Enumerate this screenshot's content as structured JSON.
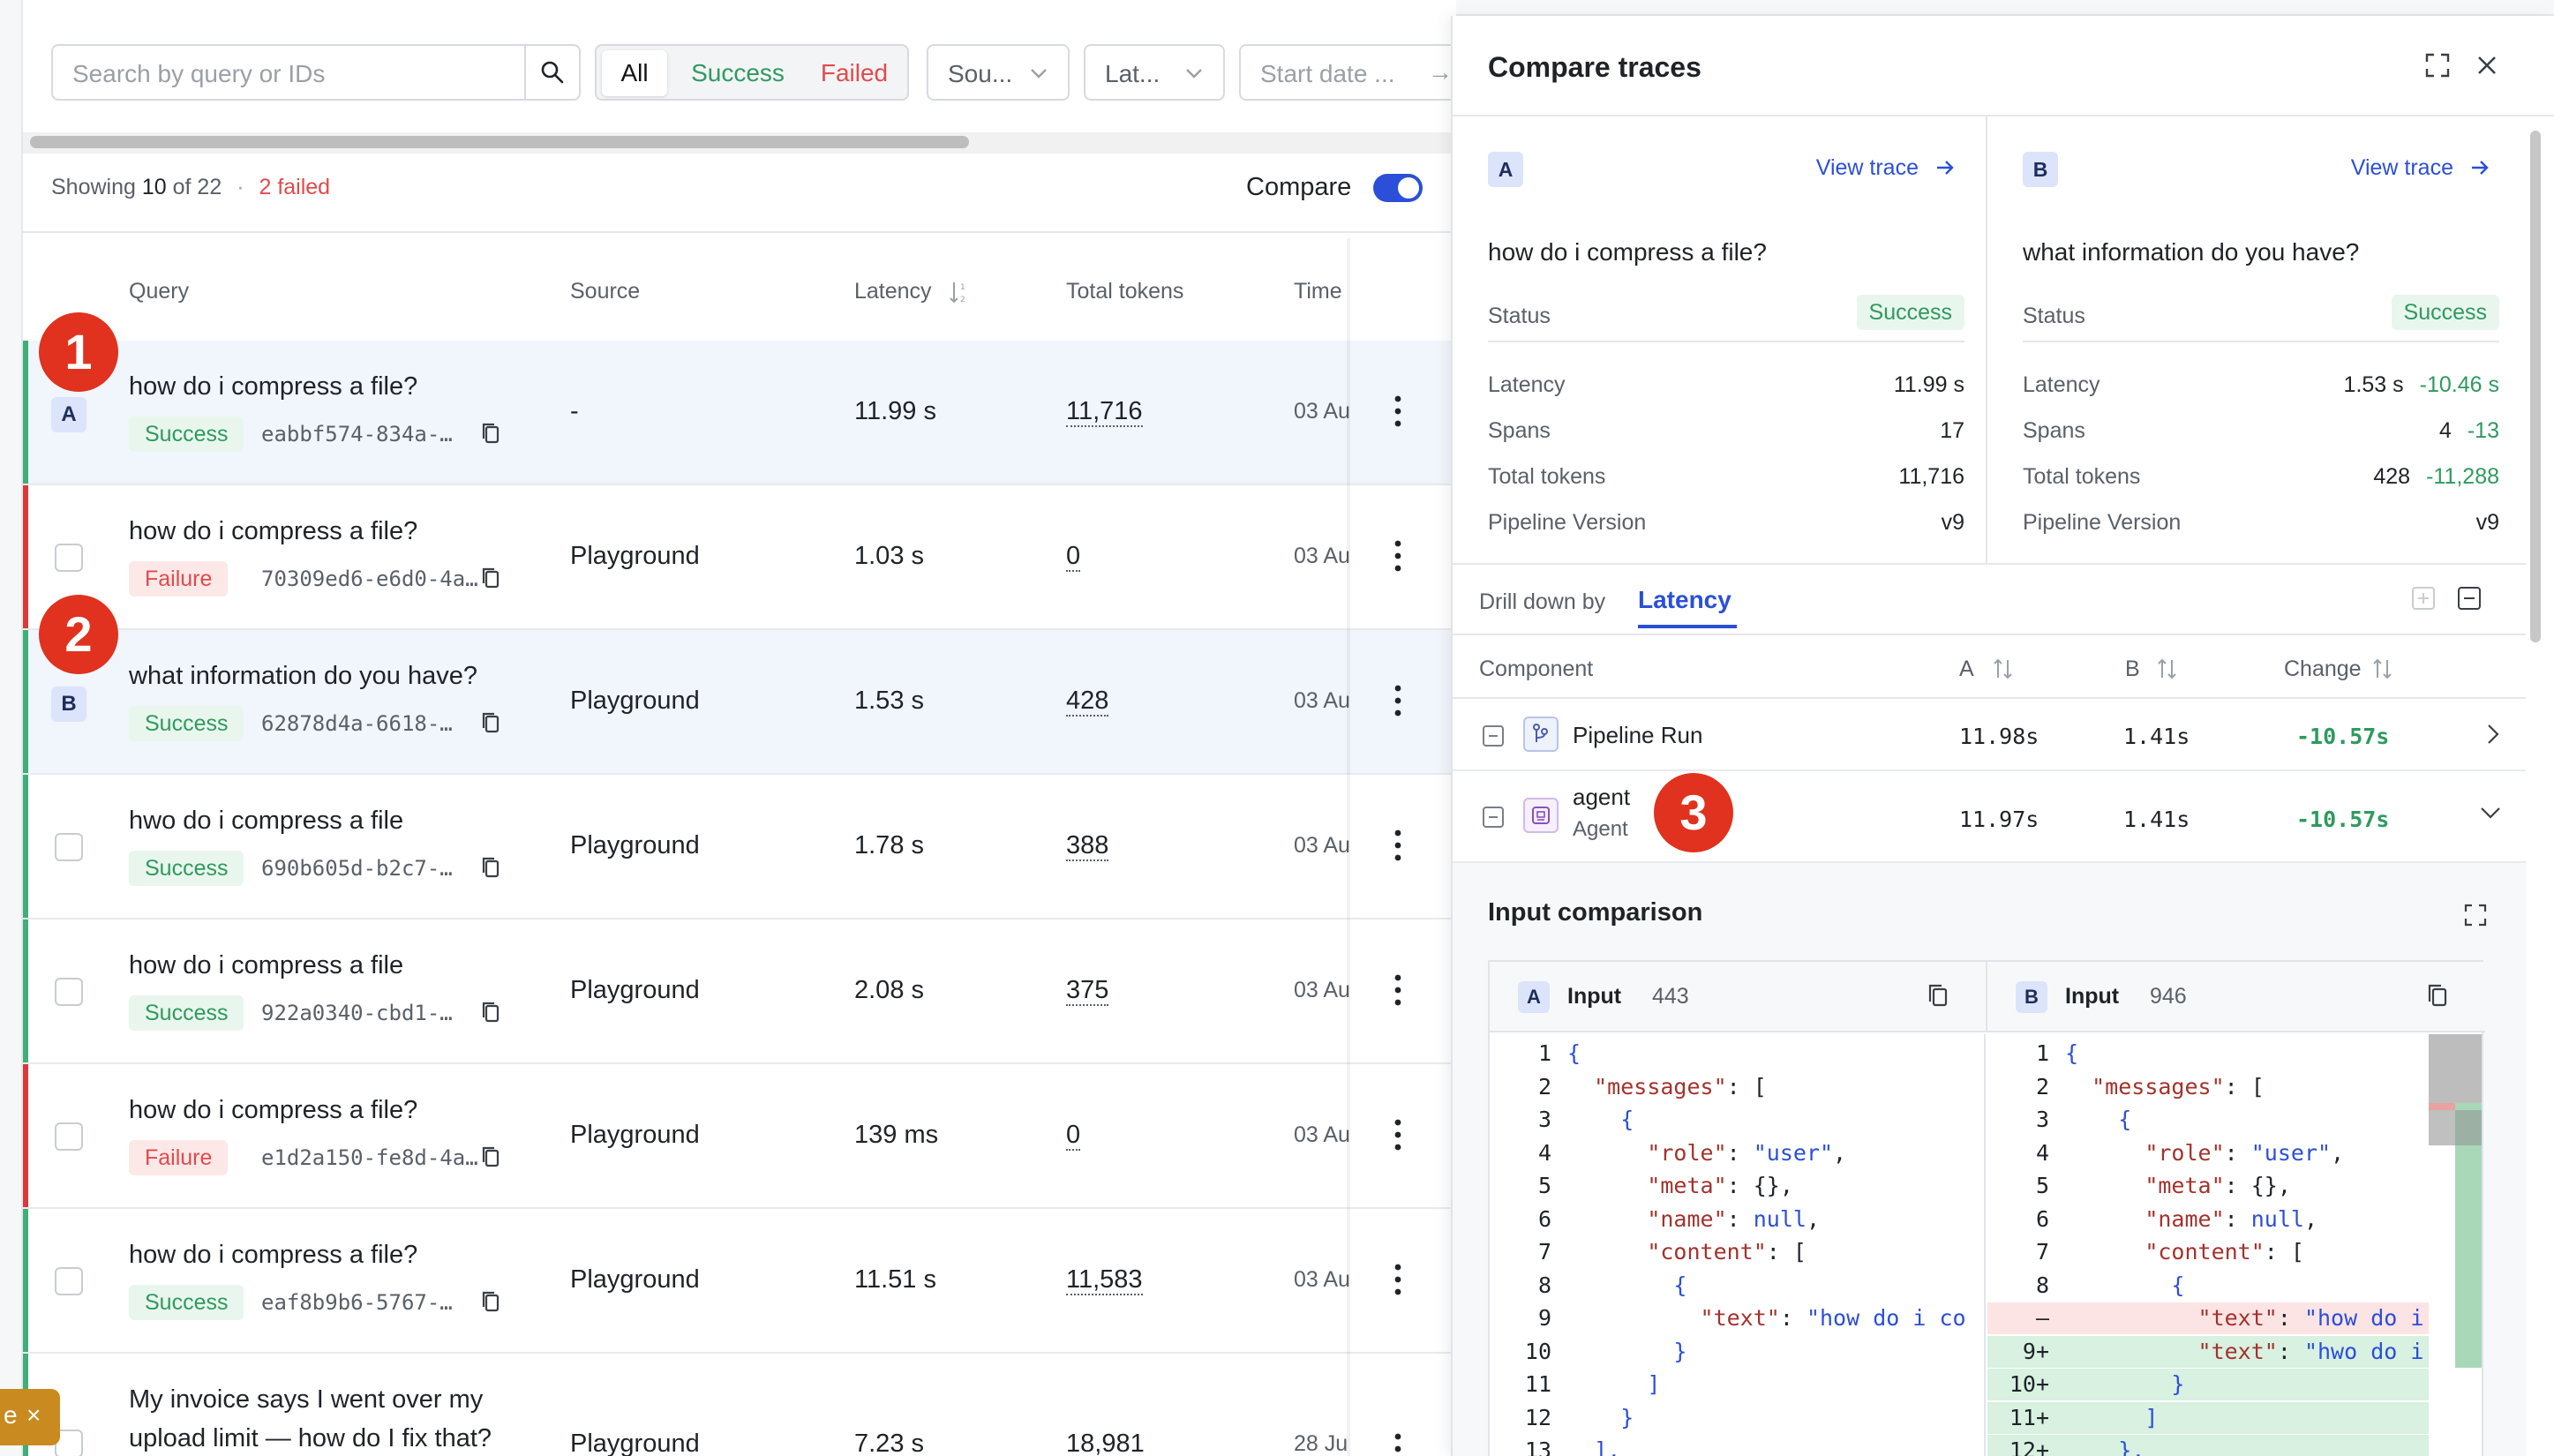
{
  "toolbar": {
    "search_placeholder": "Search by query or IDs",
    "filter_all": "All",
    "filter_success": "Success",
    "filter_failed": "Failed",
    "source_dropdown": "Sou...",
    "latency_dropdown": "Lat...",
    "start_date_placeholder": "Start date ...",
    "date_arrow": "→"
  },
  "summary": {
    "showing_prefix": "Showing",
    "shown_count": "10",
    "of_total": "of 22",
    "failed_text": "2 failed",
    "compare_label": "Compare",
    "compare_on": true
  },
  "table": {
    "headers": {
      "query": "Query",
      "source": "Source",
      "latency": "Latency",
      "tokens": "Total tokens",
      "time": "Time"
    },
    "rows": [
      {
        "marker": "A",
        "query": "how do i compress a file?",
        "status": "Success",
        "trace_id": "eabbf574-834a-…",
        "source": "-",
        "latency": "11.99 s",
        "tokens": "11,716",
        "time": "03 Au"
      },
      {
        "marker": "",
        "query": "how do i compress a file?",
        "status": "Failure",
        "trace_id": "70309ed6-e6d0-4a…",
        "source": "Playground",
        "latency": "1.03 s",
        "tokens": "0",
        "time": "03 Au"
      },
      {
        "marker": "B",
        "query": "what information do you have?",
        "status": "Success",
        "trace_id": "62878d4a-6618-…",
        "source": "Playground",
        "latency": "1.53 s",
        "tokens": "428",
        "time": "03 Au"
      },
      {
        "marker": "",
        "query": "hwo do i compress a file",
        "status": "Success",
        "trace_id": "690b605d-b2c7-…",
        "source": "Playground",
        "latency": "1.78 s",
        "tokens": "388",
        "time": "03 Au"
      },
      {
        "marker": "",
        "query": "how do i compress a file",
        "status": "Success",
        "trace_id": "922a0340-cbd1-…",
        "source": "Playground",
        "latency": "2.08 s",
        "tokens": "375",
        "time": "03 Au"
      },
      {
        "marker": "",
        "query": "how do i compress a file?",
        "status": "Failure",
        "trace_id": "e1d2a150-fe8d-4a…",
        "source": "Playground",
        "latency": "139 ms",
        "tokens": "0",
        "time": "03 Au"
      },
      {
        "marker": "",
        "query": "how do i compress a file?",
        "status": "Success",
        "trace_id": "eaf8b9b6-5767-…",
        "source": "Playground",
        "latency": "11.51 s",
        "tokens": "11,583",
        "time": "03 Au"
      },
      {
        "marker": "",
        "query_line1": "My invoice says I went over my",
        "query_line2": "upload limit — how do I fix that?",
        "source": "Playground",
        "latency": "7.23 s",
        "tokens": "18,981",
        "time": "28 Ju"
      }
    ]
  },
  "annotations": {
    "one": "1",
    "two": "2",
    "three": "3"
  },
  "toast": {
    "left_char": "e",
    "close": "×"
  },
  "compare_panel": {
    "title": "Compare traces",
    "view_trace": "View trace",
    "a": {
      "label": "A",
      "query": "how do i compress a file?",
      "status_key": "Status",
      "status": "Success",
      "latency_key": "Latency",
      "latency": "11.99 s",
      "spans_key": "Spans",
      "spans": "17",
      "tokens_key": "Total tokens",
      "tokens": "11,716",
      "version_key": "Pipeline Version",
      "version": "v9"
    },
    "b": {
      "label": "B",
      "query": "what information do you have?",
      "status_key": "Status",
      "status": "Success",
      "latency_key": "Latency",
      "latency": "1.53 s",
      "latency_delta": "-10.46 s",
      "spans_key": "Spans",
      "spans": "4",
      "spans_delta": "-13",
      "tokens_key": "Total tokens",
      "tokens": "428",
      "tokens_delta": "-11,288",
      "version_key": "Pipeline Version",
      "version": "v9"
    },
    "drill_label": "Drill down by",
    "drill_tab": "Latency",
    "comp_headers": {
      "component": "Component",
      "a": "A",
      "b": "B",
      "change": "Change"
    },
    "components": [
      {
        "name": "Pipeline Run",
        "a": "11.98s",
        "b": "1.41s",
        "change": "-10.57s"
      },
      {
        "name": "agent",
        "sub": "Agent",
        "a": "11.97s",
        "b": "1.41s",
        "change": "-10.57s"
      }
    ],
    "input_title": "Input comparison",
    "input_a": {
      "label": "A",
      "name": "Input",
      "count": "443"
    },
    "input_b": {
      "label": "B",
      "name": "Input",
      "count": "946"
    },
    "code_a": [
      {
        "n": "1",
        "t": "{"
      },
      {
        "n": "2",
        "t": "  \"messages\": ["
      },
      {
        "n": "3",
        "t": "    {"
      },
      {
        "n": "4",
        "t": "      \"role\": \"user\","
      },
      {
        "n": "5",
        "t": "      \"meta\": {},"
      },
      {
        "n": "6",
        "t": "      \"name\": null,"
      },
      {
        "n": "7",
        "t": "      \"content\": ["
      },
      {
        "n": "8",
        "t": "        {"
      },
      {
        "n": "9",
        "t": "          \"text\": \"how do i co"
      },
      {
        "n": "10",
        "t": "        }"
      },
      {
        "n": "11",
        "t": "      ]"
      },
      {
        "n": "12",
        "t": "    }"
      },
      {
        "n": "13",
        "t": "  ],"
      }
    ],
    "code_b": [
      {
        "n": "1",
        "t": "{"
      },
      {
        "n": "2",
        "t": "  \"messages\": ["
      },
      {
        "n": "3",
        "t": "    {"
      },
      {
        "n": "4",
        "t": "      \"role\": \"user\","
      },
      {
        "n": "5",
        "t": "      \"meta\": {},"
      },
      {
        "n": "6",
        "t": "      \"name\": null,"
      },
      {
        "n": "7",
        "t": "      \"content\": ["
      },
      {
        "n": "8",
        "t": "        {"
      },
      {
        "n": "—",
        "t": "          \"text\": \"how do i"
      },
      {
        "n": "9+",
        "t": "          \"text\": \"hwo do i"
      },
      {
        "n": "10+",
        "t": "        }"
      },
      {
        "n": "11+",
        "t": "      ]"
      },
      {
        "n": "12+",
        "t": "    },"
      }
    ]
  }
}
